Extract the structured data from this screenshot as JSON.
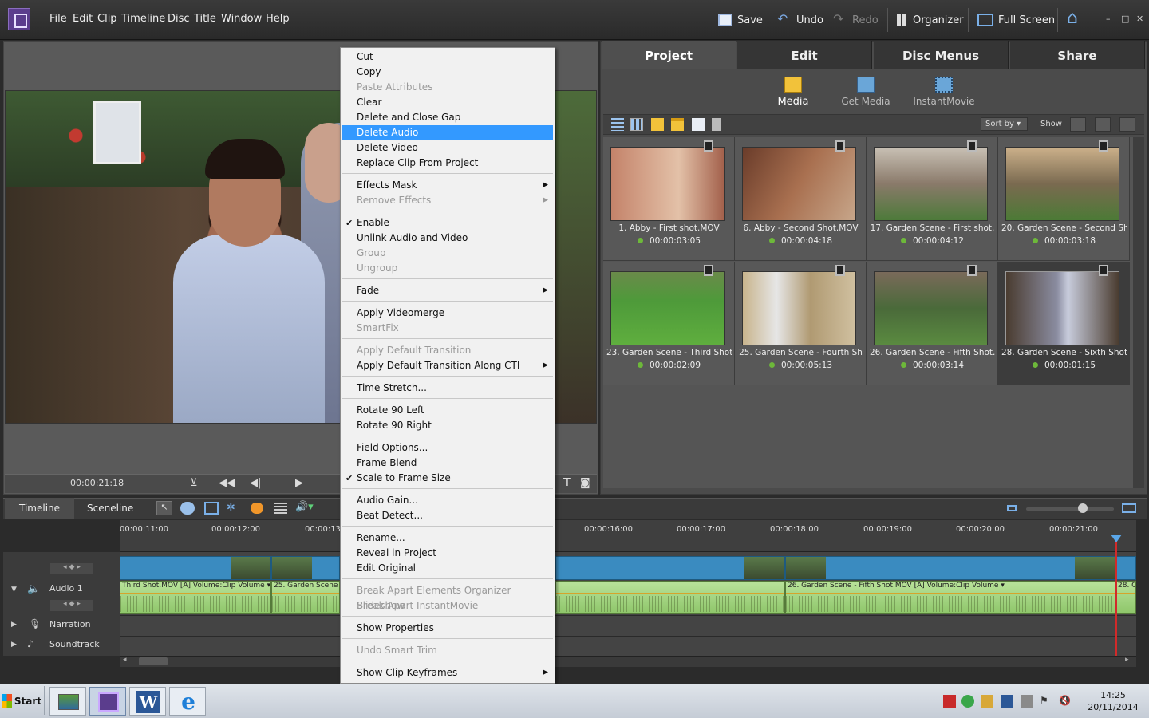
{
  "menubar": {
    "items": [
      "File",
      "Edit",
      "Clip",
      "Timeline",
      "Disc",
      "Title",
      "Window",
      "Help"
    ],
    "save": "Save",
    "undo": "Undo",
    "redo": "Redo",
    "organizer": "Organizer",
    "full_screen": "Full Screen"
  },
  "monitor": {
    "timecode": "00:00:21:18"
  },
  "panel": {
    "tabs": [
      "Project",
      "Edit",
      "Disc Menus",
      "Share"
    ],
    "subtabs": [
      "Media",
      "Get Media",
      "InstantMovie"
    ],
    "sort_by": "Sort by",
    "show": "Show"
  },
  "media": [
    {
      "name": "1. Abby - First shot.MOV",
      "duration": "00:00:03:05"
    },
    {
      "name": "6. Abby - Second Shot.MOV",
      "duration": "00:00:04:18"
    },
    {
      "name": "17. Garden Scene - First shot.",
      "duration": "00:00:04:12"
    },
    {
      "name": "20. Garden Scene - Second Sh",
      "duration": "00:00:03:18"
    },
    {
      "name": "23. Garden Scene - Third Shot",
      "duration": "00:00:02:09"
    },
    {
      "name": "25. Garden Scene - Fourth Sh",
      "duration": "00:00:05:13"
    },
    {
      "name": "26. Garden Scene - Fifth Shot.",
      "duration": "00:00:03:14"
    },
    {
      "name": "28. Garden Scene - Sixth Shot.",
      "duration": "00:00:01:15"
    }
  ],
  "timeline": {
    "tabs": [
      "Timeline",
      "Sceneline"
    ],
    "ticks": [
      "00:00:11:00",
      "00:00:12:00",
      "00:00:13:",
      "00:00:16:00",
      "00:00:17:00",
      "00:00:18:00",
      "00:00:19:00",
      "00:00:20:00",
      "00:00:21:00"
    ],
    "tracks": {
      "audio1": "Audio 1",
      "narration": "Narration",
      "soundtrack": "Soundtrack"
    },
    "clip_labels": {
      "a1": "Third Shot.MOV [A]  Volume:Clip Volume ▾",
      "a2": "25. Garden Scene - ",
      "a3": "26. Garden Scene - Fifth Shot.MOV [A]  Volume:Clip Volume ▾",
      "a4": "28. G"
    }
  },
  "context_menu": {
    "cut": "Cut",
    "copy": "Copy",
    "paste_attributes": "Paste Attributes",
    "clear": "Clear",
    "delete_close_gap": "Delete and Close Gap",
    "delete_audio": "Delete Audio",
    "delete_video": "Delete Video",
    "replace_clip": "Replace Clip From Project",
    "effects_mask": "Effects Mask",
    "remove_effects": "Remove Effects",
    "enable": "Enable",
    "unlink": "Unlink Audio and Video",
    "group": "Group",
    "ungroup": "Ungroup",
    "fade": "Fade",
    "apply_videomerge": "Apply Videomerge",
    "smartfix": "SmartFix",
    "apply_default_transition": "Apply Default Transition",
    "apply_default_transition_cti": "Apply Default Transition Along CTI",
    "time_stretch": "Time Stretch...",
    "rotate_left": "Rotate 90 Left",
    "rotate_right": "Rotate 90 Right",
    "field_options": "Field Options...",
    "frame_blend": "Frame Blend",
    "scale_to_frame": "Scale to Frame Size",
    "audio_gain": "Audio Gain...",
    "beat_detect": "Beat Detect...",
    "rename": "Rename...",
    "reveal": "Reveal in Project",
    "edit_original": "Edit Original",
    "break_apart_organizer": "Break Apart Elements Organizer Slideshow",
    "break_apart_instant": "Break Apart InstantMovie",
    "show_properties": "Show Properties",
    "undo_smart_trim": "Undo Smart Trim",
    "show_keyframes": "Show Clip Keyframes"
  },
  "taskbar": {
    "start": "Start",
    "time": "14:25",
    "date": "20/11/2014"
  },
  "colors": {
    "highlight": "#3399ff",
    "audio_clip": "#9fd27a",
    "video_clip": "#3a8bc0",
    "playhead": "#d12a2a"
  }
}
